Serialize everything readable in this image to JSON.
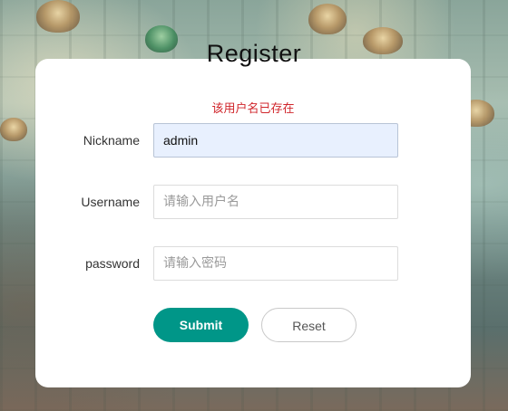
{
  "page": {
    "title": "Register"
  },
  "form": {
    "error_message": "该用户名已存在",
    "nickname": {
      "label": "Nickname",
      "value": "admin",
      "placeholder": ""
    },
    "username": {
      "label": "Username",
      "value": "",
      "placeholder": "请输入用户名"
    },
    "password": {
      "label": "password",
      "value": "",
      "placeholder": "请输入密码"
    },
    "submit_label": "Submit",
    "reset_label": "Reset"
  },
  "colors": {
    "accent": "#009688",
    "error": "#d0252b",
    "autofill_bg": "#e8f0fe"
  }
}
